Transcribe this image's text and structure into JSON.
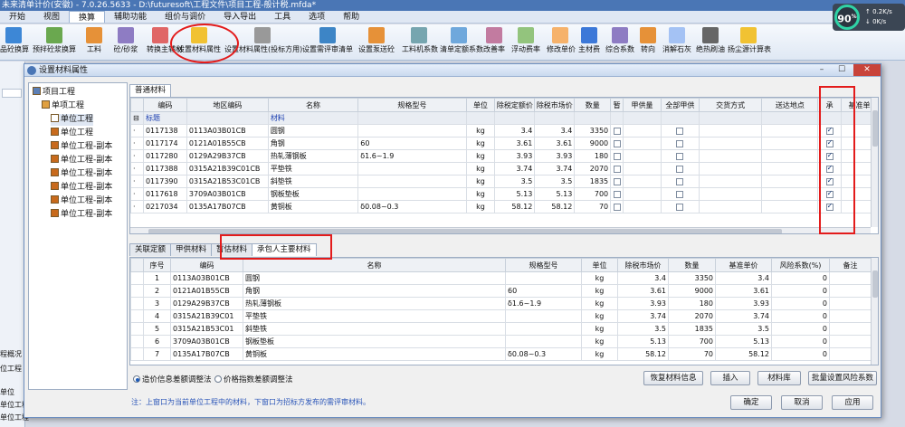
{
  "window": {
    "title": "未来清单计价(安徽) - 7.0.26.5633 - D:\\futuresoft\\工程文件\\项目工程-般计税.mfda*"
  },
  "menu": [
    "开始",
    "视图",
    "换算",
    "辅助功能",
    "组价与调价",
    "导入导出",
    "工具",
    "选项",
    "帮助"
  ],
  "toolbar": [
    {
      "label": "品砼换算",
      "color": "#3d87d6"
    },
    {
      "label": "预拌砼浆换算",
      "color": "#6aa84f"
    },
    {
      "label": "工料",
      "color": "#e69138"
    },
    {
      "label": "砼/砂浆",
      "color": "#8e7cc3"
    },
    {
      "label": "转换主辅材",
      "color": "#e06666"
    },
    {
      "label": "设置材料属性",
      "color": "#f1c232"
    },
    {
      "label": "设置材料属性(投标方用)",
      "color": "#999999"
    },
    {
      "label": "设置需评审清单",
      "color": "#3d85c6"
    },
    {
      "label": "设置泵送砼",
      "color": "#e69138"
    },
    {
      "label": "工料机系数",
      "color": "#76a5af"
    },
    {
      "label": "清单定额系数",
      "color": "#6fa8dc"
    },
    {
      "label": "改善率",
      "color": "#c27ba0"
    },
    {
      "label": "浮动费率",
      "color": "#93c47d"
    },
    {
      "label": "修改单价",
      "color": "#f6b26b"
    },
    {
      "label": "主材费",
      "color": "#3c78d8"
    },
    {
      "label": "综合系数",
      "color": "#8e7cc3"
    },
    {
      "label": "转向",
      "color": "#e69138"
    },
    {
      "label": "消解石灰",
      "color": "#a4c2f4"
    },
    {
      "label": "绝热刷油",
      "color": "#666666"
    },
    {
      "label": "扬尘源计算表",
      "color": "#f1c232"
    }
  ],
  "meter": {
    "value": "90",
    "unit": "%",
    "up": "0.2K/s",
    "down": "0K/s"
  },
  "dialog": {
    "title": "设置材料属性",
    "min": "–",
    "max": "☐",
    "close": "✕"
  },
  "tree": [
    {
      "label": "项目工程",
      "level": 0
    },
    {
      "label": "单项工程",
      "level": 1
    },
    {
      "label": "单位工程",
      "level": 2,
      "selected": true
    },
    {
      "label": "单位工程",
      "level": 2
    },
    {
      "label": "单位工程-副本",
      "level": 2
    },
    {
      "label": "单位工程-副本",
      "level": 2
    },
    {
      "label": "单位工程-副本",
      "level": 2
    },
    {
      "label": "单位工程-副本",
      "level": 2
    },
    {
      "label": "单位工程-副本",
      "level": 2
    },
    {
      "label": "单位工程-副本",
      "level": 2
    }
  ],
  "upper_tab": "普通材料",
  "upper_headers": [
    "编码",
    "地区编码",
    "名称",
    "规格型号",
    "单位",
    "除税定额价",
    "除税市场价",
    "数量",
    "暂",
    "甲供量",
    "全部甲供",
    "交货方式",
    "送达地点",
    "承",
    "基准单"
  ],
  "upper_group": {
    "code": "标题",
    "name": "材料"
  },
  "upper_rows": [
    {
      "code": "0117138",
      "area": "0113A03B01CB",
      "name": "圆钢",
      "spec": "",
      "unit": "kg",
      "price": "3.4",
      "market": "3.4",
      "qty": "3350"
    },
    {
      "code": "0117174",
      "area": "0121A01B55CB",
      "name": "角钢",
      "spec": "60",
      "unit": "kg",
      "price": "3.61",
      "market": "3.61",
      "qty": "9000"
    },
    {
      "code": "0117280",
      "area": "0129A29B37CB",
      "name": "热轧薄钢板",
      "spec": "δ1.6~1.9",
      "unit": "kg",
      "price": "3.93",
      "market": "3.93",
      "qty": "180"
    },
    {
      "code": "0117388",
      "area": "0315A21B39C01CB",
      "name": "平垫铁",
      "spec": "",
      "unit": "kg",
      "price": "3.74",
      "market": "3.74",
      "qty": "2070"
    },
    {
      "code": "0117390",
      "area": "0315A21B53C01CB",
      "name": "斜垫铁",
      "spec": "",
      "unit": "kg",
      "price": "3.5",
      "market": "3.5",
      "qty": "1835"
    },
    {
      "code": "0117618",
      "area": "3709A03B01CB",
      "name": "钢板垫板",
      "spec": "",
      "unit": "kg",
      "price": "5.13",
      "market": "5.13",
      "qty": "700"
    },
    {
      "code": "0217034",
      "area": "0135A17B07CB",
      "name": "黄铜板",
      "spec": "δ0.08~0.3",
      "unit": "kg",
      "price": "58.12",
      "market": "58.12",
      "qty": "70"
    }
  ],
  "lower_tabs": [
    "关联定额",
    "甲供材料",
    "暂估材料",
    "承包人主要材料"
  ],
  "lower_headers": [
    "序号",
    "编码",
    "名称",
    "规格型号",
    "单位",
    "除税市场价",
    "数量",
    "基准单价",
    "风险系数(%)",
    "备注"
  ],
  "lower_rows": [
    {
      "no": "1",
      "code": "0113A03B01CB",
      "name": "圆钢",
      "spec": "",
      "unit": "kg",
      "market": "3.4",
      "qty": "3350",
      "base": "3.4",
      "risk": "0"
    },
    {
      "no": "2",
      "code": "0121A01B55CB",
      "name": "角钢",
      "spec": "60",
      "unit": "kg",
      "market": "3.61",
      "qty": "9000",
      "base": "3.61",
      "risk": "0"
    },
    {
      "no": "3",
      "code": "0129A29B37CB",
      "name": "热轧薄钢板",
      "spec": "δ1.6~1.9",
      "unit": "kg",
      "market": "3.93",
      "qty": "180",
      "base": "3.93",
      "risk": "0"
    },
    {
      "no": "4",
      "code": "0315A21B39C01",
      "name": "平垫铁",
      "spec": "",
      "unit": "kg",
      "market": "3.74",
      "qty": "2070",
      "base": "3.74",
      "risk": "0"
    },
    {
      "no": "5",
      "code": "0315A21B53C01",
      "name": "斜垫铁",
      "spec": "",
      "unit": "kg",
      "market": "3.5",
      "qty": "1835",
      "base": "3.5",
      "risk": "0"
    },
    {
      "no": "6",
      "code": "3709A03B01CB",
      "name": "钢板垫板",
      "spec": "",
      "unit": "kg",
      "market": "5.13",
      "qty": "700",
      "base": "5.13",
      "risk": "0"
    },
    {
      "no": "7",
      "code": "0135A17B07CB",
      "name": "黄铜板",
      "spec": "δ0.08~0.3",
      "unit": "kg",
      "market": "58.12",
      "qty": "70",
      "base": "58.12",
      "risk": "0"
    }
  ],
  "radios": [
    "造价信息差额调整法",
    "价格指数差额调整法"
  ],
  "buttons": {
    "restore": "恢复材料信息",
    "insert": "插入",
    "library": "材料库",
    "batch": "批量设置风险系数",
    "ok": "确定",
    "cancel": "取消",
    "apply": "应用"
  },
  "note": "注：上窗口为当前单位工程中的材料，下窗口为招标方发布的需评审材料。",
  "left_bottom": [
    "程概况",
    "位工程",
    "单位",
    "单位工程",
    "单位工程"
  ],
  "colors": {
    "accent": "#4a76b5",
    "annotation": "#e31b1b"
  }
}
